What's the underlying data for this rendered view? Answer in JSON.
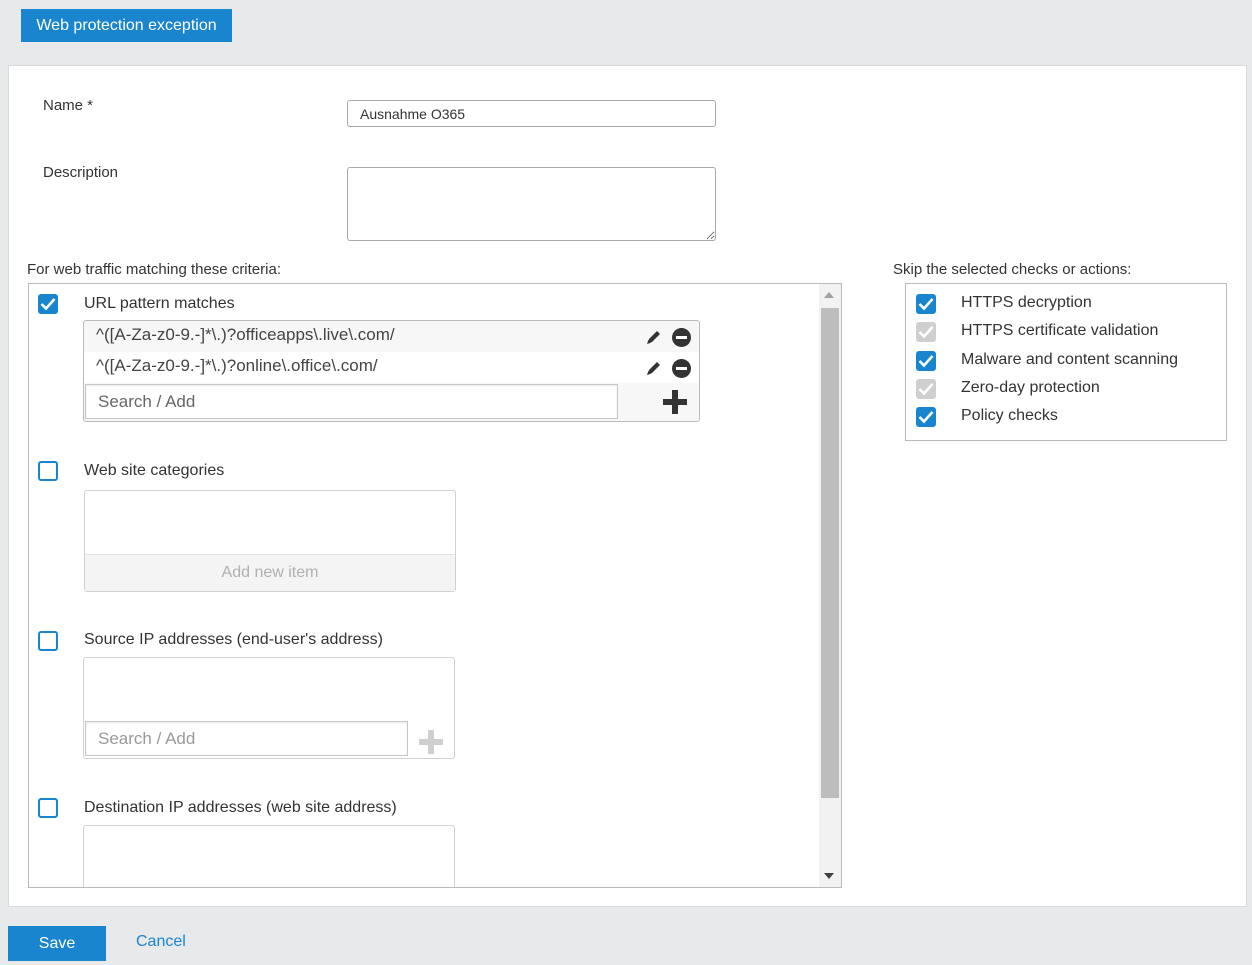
{
  "window": {
    "title": "Web protection exception"
  },
  "form": {
    "name_label": "Name *",
    "name_value": "Ausnahme O365",
    "description_label": "Description",
    "description_value": ""
  },
  "criteria": {
    "heading": "For web traffic matching these criteria:",
    "url_pattern": {
      "label": "URL pattern matches",
      "checked": true,
      "items": [
        "^([A-Za-z0-9.-]*\\.)?officeapps\\.live\\.com/",
        "^([A-Za-z0-9.-]*\\.)?online\\.office\\.com/"
      ],
      "search_placeholder": "Search / Add"
    },
    "web_categories": {
      "label": "Web site categories",
      "checked": false,
      "add_new_label": "Add new item"
    },
    "source_ip": {
      "label": "Source IP addresses (end-user's address)",
      "checked": false,
      "search_placeholder": "Search / Add"
    },
    "destination_ip": {
      "label": "Destination IP addresses (web site address)",
      "checked": false
    }
  },
  "skip": {
    "heading": "Skip the selected checks or actions:",
    "items": [
      {
        "label": "HTTPS decryption",
        "checked": true,
        "enabled": true
      },
      {
        "label": "HTTPS certificate validation",
        "checked": true,
        "enabled": false
      },
      {
        "label": "Malware and content scanning",
        "checked": true,
        "enabled": true
      },
      {
        "label": "Zero-day protection",
        "checked": true,
        "enabled": false
      },
      {
        "label": "Policy checks",
        "checked": true,
        "enabled": true
      }
    ]
  },
  "actions": {
    "save_label": "Save",
    "cancel_label": "Cancel"
  },
  "colors": {
    "accent": "#1a85cf",
    "disabled_check": "#cfcfcf",
    "background": "#e8e9eb"
  },
  "icons": {
    "edit": "pencil-icon",
    "remove": "minus-circle-icon",
    "add": "plus-icon",
    "check": "checkmark-icon"
  }
}
